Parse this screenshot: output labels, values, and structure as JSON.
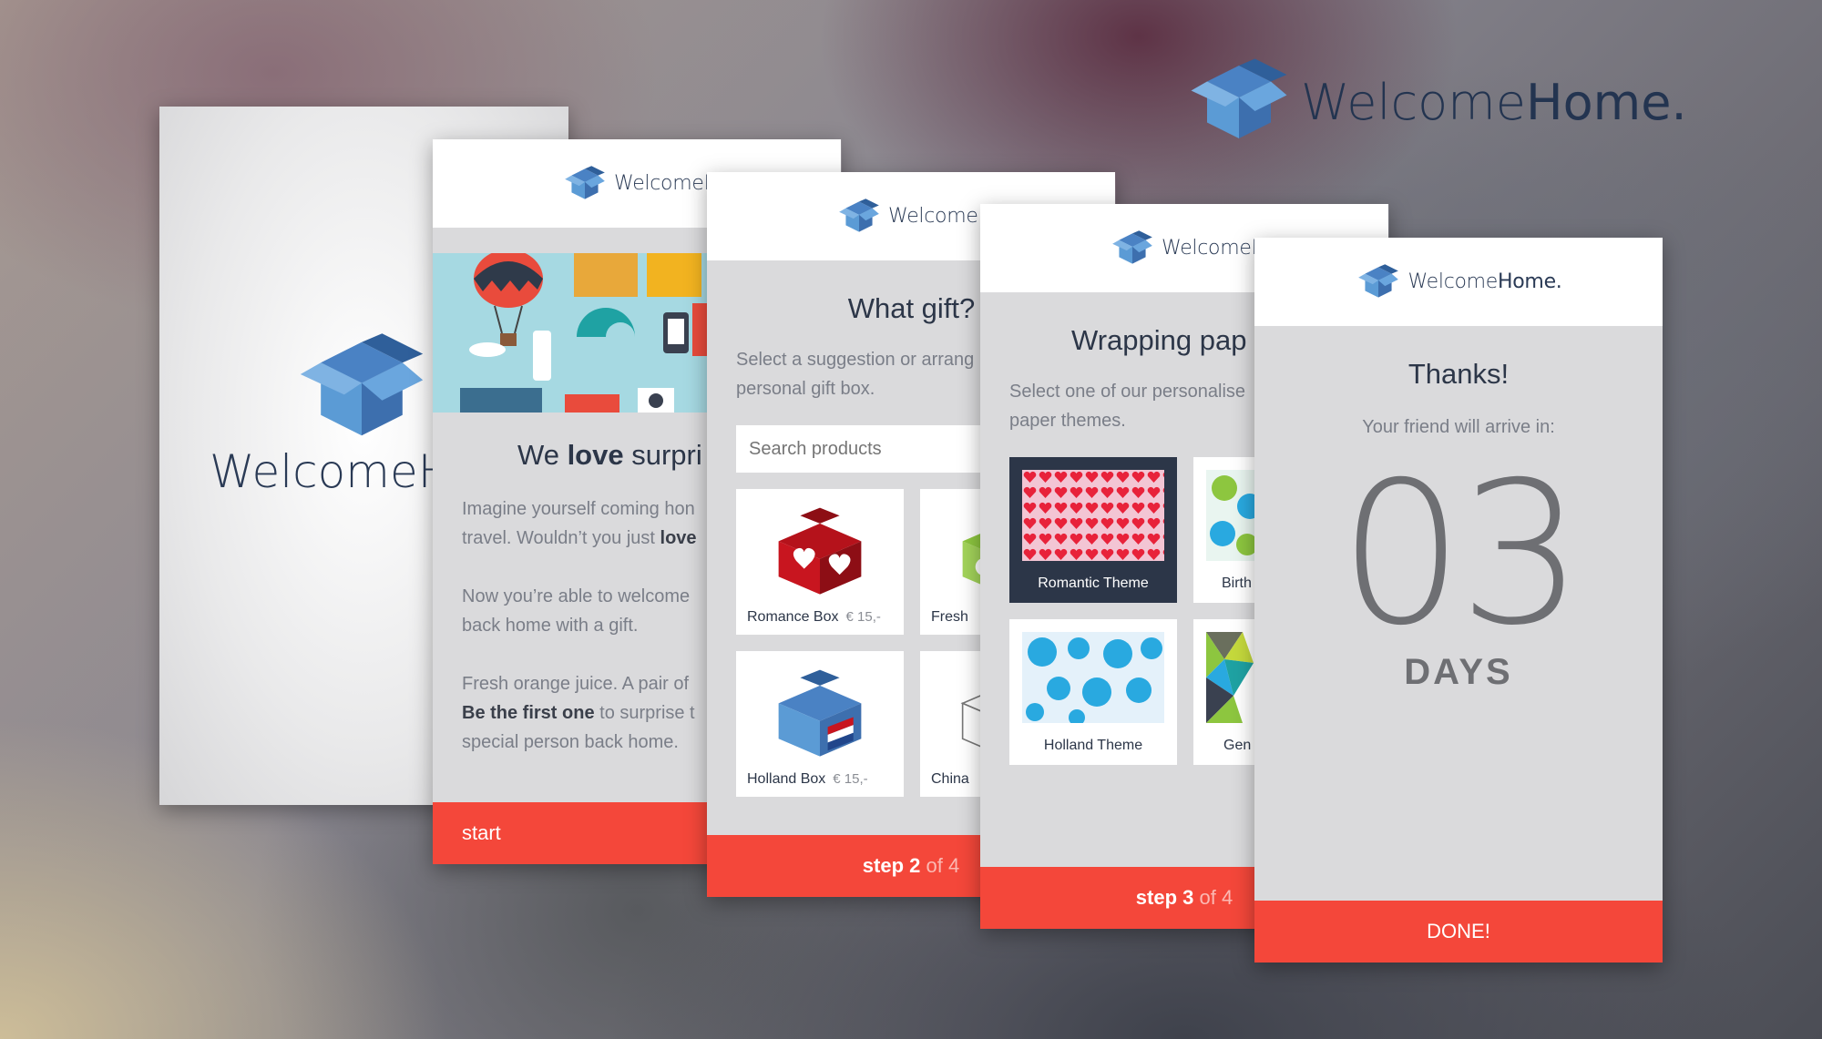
{
  "colors": {
    "brand_blue": "#5b9bd5",
    "accent_red": "#f4473a",
    "text_dark": "#2c3648",
    "text_grey": "#7a7e88"
  },
  "brand": {
    "word_light": "Welcome",
    "word_bold": "Home.",
    "splash_word": "WelcomeHo",
    "header_word_a": "WelcomeHo",
    "icon": "box-logo-icon"
  },
  "screen2": {
    "title_pre": "We ",
    "title_bold": "love",
    "title_post": " surpri",
    "p1_line1": "Imagine yourself coming hon",
    "p1_line2_pre": "travel. Wouldn’t you just ",
    "p1_line2_bold": "love",
    "p2_line1": "Now you’re able to welcome",
    "p2_line2": "back home with a gift.",
    "p3_line1": "Fresh orange juice. A pair of",
    "p3_line2_bold": "Be the first one",
    "p3_line2_post": " to surprise t",
    "p3_line3": "special person back home.",
    "footer": "start"
  },
  "screen3": {
    "title": "What gift?",
    "intro_line1": "Select a suggestion or arrang",
    "intro_line2": "personal gift box.",
    "search_placeholder": "Search products",
    "products": [
      {
        "name": "Romance Box",
        "price": "€ 15,-"
      },
      {
        "name": "Fresh",
        "price": ""
      },
      {
        "name": "Holland Box",
        "price": "€ 15,-"
      },
      {
        "name": "China",
        "price": ""
      }
    ],
    "step_word": "step",
    "step_num": "2",
    "step_of": "of 4"
  },
  "screen4": {
    "title": "Wrapping pap",
    "intro_line1": "Select one of our personalise",
    "intro_line2": "paper themes.",
    "themes": [
      "Romantic Theme",
      "Birth",
      "Holland Theme",
      "Gen"
    ],
    "step_word": "step",
    "step_num": "3",
    "step_of": "of 4"
  },
  "screen5": {
    "title": "Thanks!",
    "subtitle": "Your friend will arrive in:",
    "count": "03",
    "unit": "DAYS",
    "footer": "DONE!"
  }
}
